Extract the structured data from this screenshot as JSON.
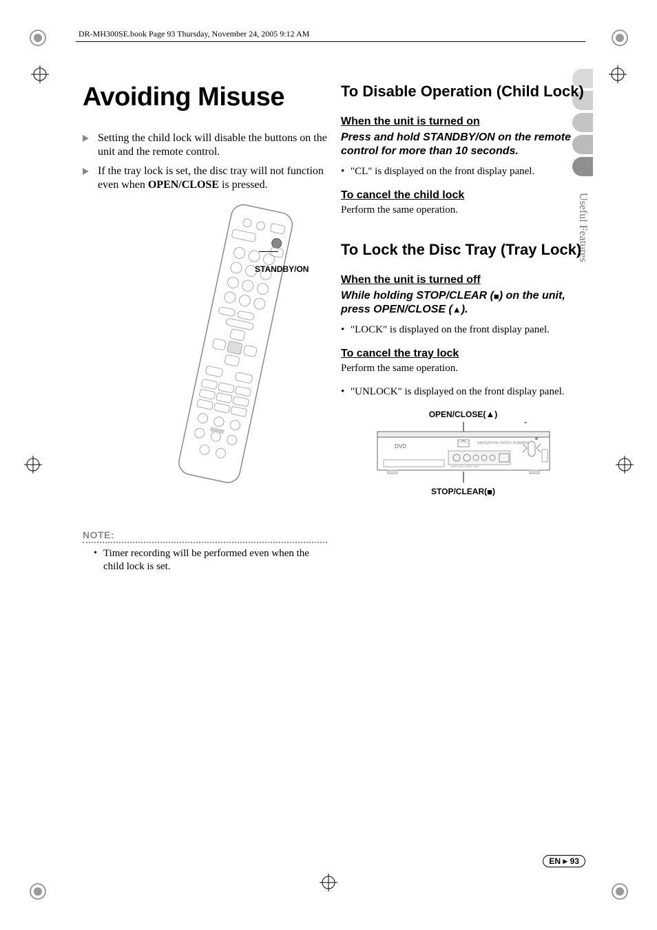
{
  "header": {
    "crop_text": "DR-MH300SE.book  Page 93  Thursday, November 24, 2005  9:12 AM"
  },
  "side": {
    "label": "Useful Features"
  },
  "left": {
    "title": "Avoiding Misuse",
    "bullets": [
      {
        "pre": "Setting the child lock will disable the buttons on the unit and the remote control."
      },
      {
        "pre": "If the tray lock is set, the disc tray will not function even when ",
        "bold": "OPEN/CLOSE",
        "post": " is pressed."
      }
    ],
    "remote_callout": "STANDBY/ON",
    "note_label": "NOTE:",
    "note_items": [
      "Timer recording will be performed even when the child lock is set."
    ]
  },
  "right": {
    "section1": {
      "heading": "To Disable Operation (Child Lock)",
      "sub1": "When the unit is turned on",
      "instruct1": "Press and hold STANDBY/ON on the remote control for more than 10 seconds.",
      "bullet1": "\"CL\" is displayed on the front display panel.",
      "sub2": "To cancel the child lock",
      "text2": "Perform the same operation."
    },
    "section2": {
      "heading": "To Lock the Disc Tray (Tray Lock)",
      "sub1": "When the unit is turned off",
      "instruct_pre": "While holding STOP/CLEAR (",
      "instruct_mid": ") on the unit, press OPEN/CLOSE (",
      "instruct_post": ").",
      "bullet1": "\"LOCK\" is displayed on the front display panel.",
      "sub2": "To cancel the tray lock",
      "text2": "Perform the same operation.",
      "bullet2": "\"UNLOCK\" is displayed on the front display panel.",
      "callout_top": "OPEN/CLOSE(",
      "callout_top_post": ")",
      "callout_bot": "STOP/CLEAR(",
      "callout_bot_post": ")"
    }
  },
  "footer": {
    "lang": "EN",
    "page": "93"
  }
}
